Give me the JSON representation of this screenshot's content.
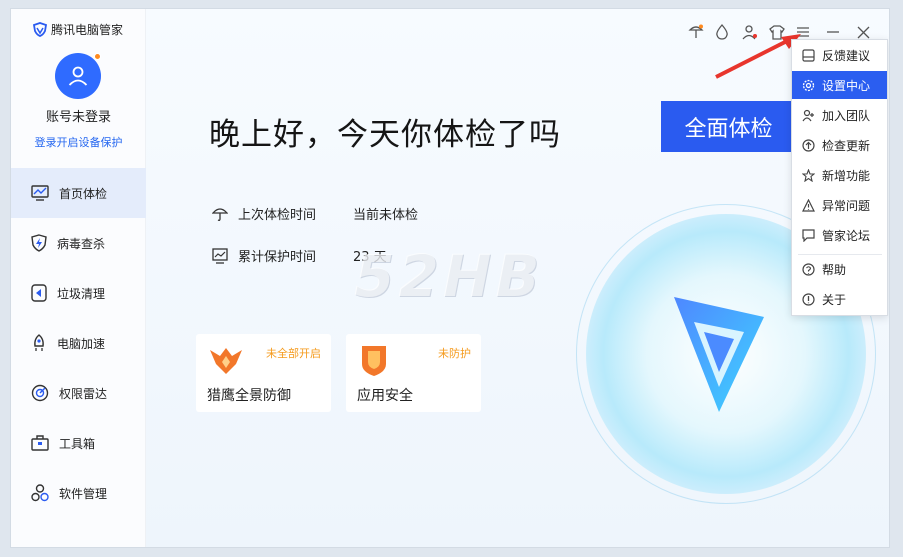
{
  "app": {
    "title": "腾讯电脑管家"
  },
  "account": {
    "name": "账号未登录",
    "login_link": "登录开启设备保护"
  },
  "sidebar": {
    "items": [
      {
        "label": "首页体检",
        "icon": "monitor-icon",
        "active": true
      },
      {
        "label": "病毒查杀",
        "icon": "shield-bolt-icon"
      },
      {
        "label": "垃圾清理",
        "icon": "broom-icon"
      },
      {
        "label": "电脑加速",
        "icon": "rocket-icon"
      },
      {
        "label": "权限雷达",
        "icon": "radar-icon"
      },
      {
        "label": "工具箱",
        "icon": "toolbox-icon"
      },
      {
        "label": "软件管理",
        "icon": "apps-icon"
      }
    ]
  },
  "main": {
    "greeting": "晚上好，今天你体检了吗",
    "scan_button": "全面体检",
    "last_check_label": "上次体检时间",
    "last_check_value": "当前未体检",
    "protect_label": "累计保护时间",
    "protect_value": "23 天",
    "cards": [
      {
        "title": "猎鹰全景防御",
        "badge": "未全部开启"
      },
      {
        "title": "应用安全",
        "badge": "未防护"
      }
    ],
    "watermark": "52HB"
  },
  "menu": {
    "items": [
      {
        "label": "反馈建议",
        "icon": "feedback-icon"
      },
      {
        "label": "设置中心",
        "icon": "settings-icon",
        "active": true
      },
      {
        "label": "加入团队",
        "icon": "add-user-icon"
      },
      {
        "label": "检查更新",
        "icon": "update-icon"
      },
      {
        "label": "新增功能",
        "icon": "star-icon"
      },
      {
        "label": "异常问题",
        "icon": "warning-icon"
      },
      {
        "label": "管家论坛",
        "icon": "forum-icon"
      },
      {
        "label": "帮助",
        "icon": "help-icon"
      },
      {
        "label": "关于",
        "icon": "info-icon"
      }
    ]
  },
  "colors": {
    "accent": "#2a5bf0",
    "warning": "#f59b1d",
    "annotation_arrow": "#e8352d"
  }
}
